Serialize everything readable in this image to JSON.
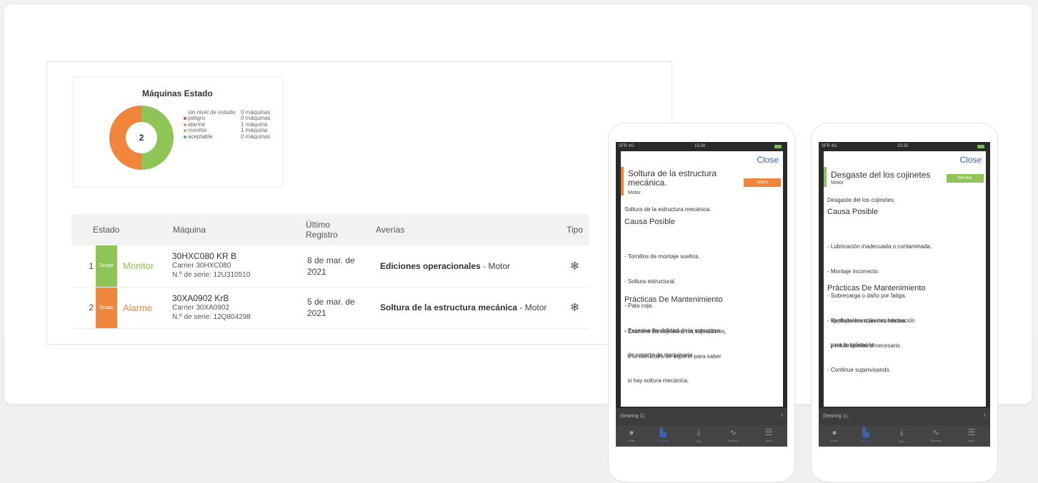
{
  "chart": {
    "title": "Máquinas Estado",
    "center_value": "2",
    "colors": {
      "alarme": "#f0863b",
      "monitor": "#8fc456"
    },
    "chart_data": {
      "type": "pie",
      "title": "Máquinas Estado",
      "categories": [
        "sin nivel de estado",
        "peligro",
        "alarme",
        "monitor",
        "aceptable"
      ],
      "values": [
        0,
        0,
        1,
        1,
        0
      ]
    },
    "legend": [
      {
        "name": "sin nivel de estado",
        "value": "0 máquinas",
        "color": ""
      },
      {
        "name": "peligro",
        "value": "0 máquinas",
        "color": "#e84b3a"
      },
      {
        "name": "alarme",
        "value": "1 máquina",
        "color": "#f0863b"
      },
      {
        "name": "monitor",
        "value": "1 máquina",
        "color": "#8fc456"
      },
      {
        "name": "aceptable",
        "value": "0 máquinas",
        "color": "#3cb878"
      }
    ]
  },
  "table": {
    "headers": {
      "estado": "Estado",
      "maquina": "Máquina",
      "registro": "Último Registro",
      "averias": "Averías",
      "tipo": "Tipo"
    },
    "rows": [
      {
        "num": "1",
        "scope": "Scope",
        "status": "Monitor",
        "machine": "30HXC080 KR B",
        "carrier": "Carrier   30HXC080",
        "serial": "N.º de serie: 12U310510",
        "date": "8 de mar. de 2021",
        "fault_bold": "Ediciones operacionales",
        "fault_rest": " - Motor",
        "type_icon": "❄"
      },
      {
        "num": "2",
        "scope": "Scope",
        "status": "Alarme",
        "machine": "30XA0902 KrB",
        "carrier": "Carrier   30XA0902",
        "serial": "N.º de serie: 12Q804298",
        "date": "5 de mar. de 2021",
        "fault_bold": "Soltura de la estructura mecánica",
        "fault_rest": " - Motor",
        "type_icon": "❄"
      }
    ]
  },
  "phone1": {
    "carrier": "SFR 4G",
    "time": "15:34",
    "close": "Close",
    "title": "Soltura de la estructura mecánica.",
    "subtitle": "Motor",
    "badge": "Alarm",
    "badge_color": "#f0863b",
    "description": "Soltura de la estructura mecánica.",
    "cause_heading": "Causa Posible",
    "causes": [
      "- Tornillos de montaje sueltos.",
      "- Soltura estructural.",
      "- Pata coja.",
      "- Excesiva flexibilidad de la estructura",
      "  de soporte de maquinaria."
    ],
    "practice_heading": "Prácticas De Mantenimiento",
    "practices": [
      "- Examine los cojinetes, los sujetadores,",
      "  o la estructura de soporte para saber",
      "  si hay soltura mecánica."
    ],
    "behind_text": "(bearing 1).",
    "tabs": [
      "Home",
      "Buildings",
      "Infos",
      "Sensors",
      "More"
    ]
  },
  "phone2": {
    "carrier": "SFR 4G",
    "time": "15:35",
    "close": "Close",
    "title": "Desgaste del los cojinetes",
    "subtitle": "Motor",
    "badge": "Monitor",
    "badge_color": "#8fc456",
    "description": "Desgaste del los cojinetes",
    "cause_heading": "Causa Posible",
    "causes": [
      "- Lubricación inadecuada o contaminada.",
      "- Montaje incorrecto.",
      "- Sobrecarga o daño por fatiga.",
      "- Ajuste/tolerancias incorrectas",
      "  para la aplicación."
    ],
    "practice_heading": "Prácticas De Mantenimiento",
    "practices": [
      "- Verifique los cojinetes lubricación",
      "  y relubríquelos si necesario.",
      "- Continue supervisando."
    ],
    "behind_text": "(bearing 1).",
    "tabs": [
      "Home",
      "Buildings",
      "Infos",
      "Sensors",
      "More"
    ]
  }
}
